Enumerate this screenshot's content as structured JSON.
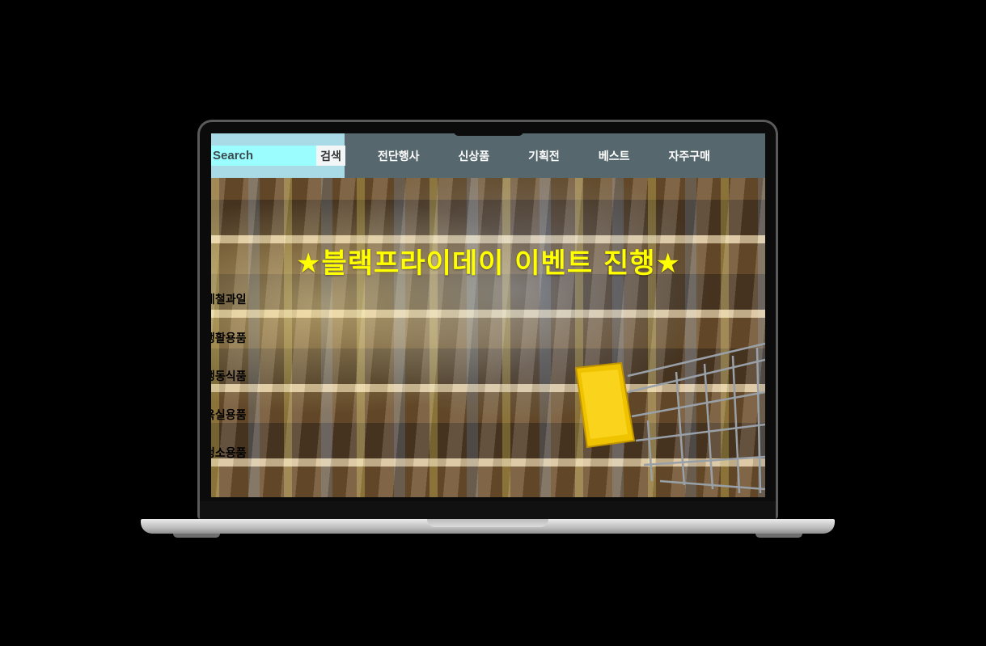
{
  "search": {
    "placeholder": "Search",
    "button_label": "검색"
  },
  "nav": {
    "items": [
      "전단행사",
      "신상품",
      "기획전",
      "베스트",
      "자주구매"
    ]
  },
  "banner": {
    "title": "★블랙프라이데이 이벤트 진행★"
  },
  "categories": [
    "과일",
    "생활용품",
    "냉동식품",
    "욕실용품",
    "청소용품"
  ],
  "category_prefix": [
    "제철",
    "",
    "",
    "",
    ""
  ],
  "colors": {
    "header_bg": "#56676d",
    "search_bg": "#9cfdff",
    "banner_text": "#ffff00",
    "page_bg": "#000000"
  }
}
